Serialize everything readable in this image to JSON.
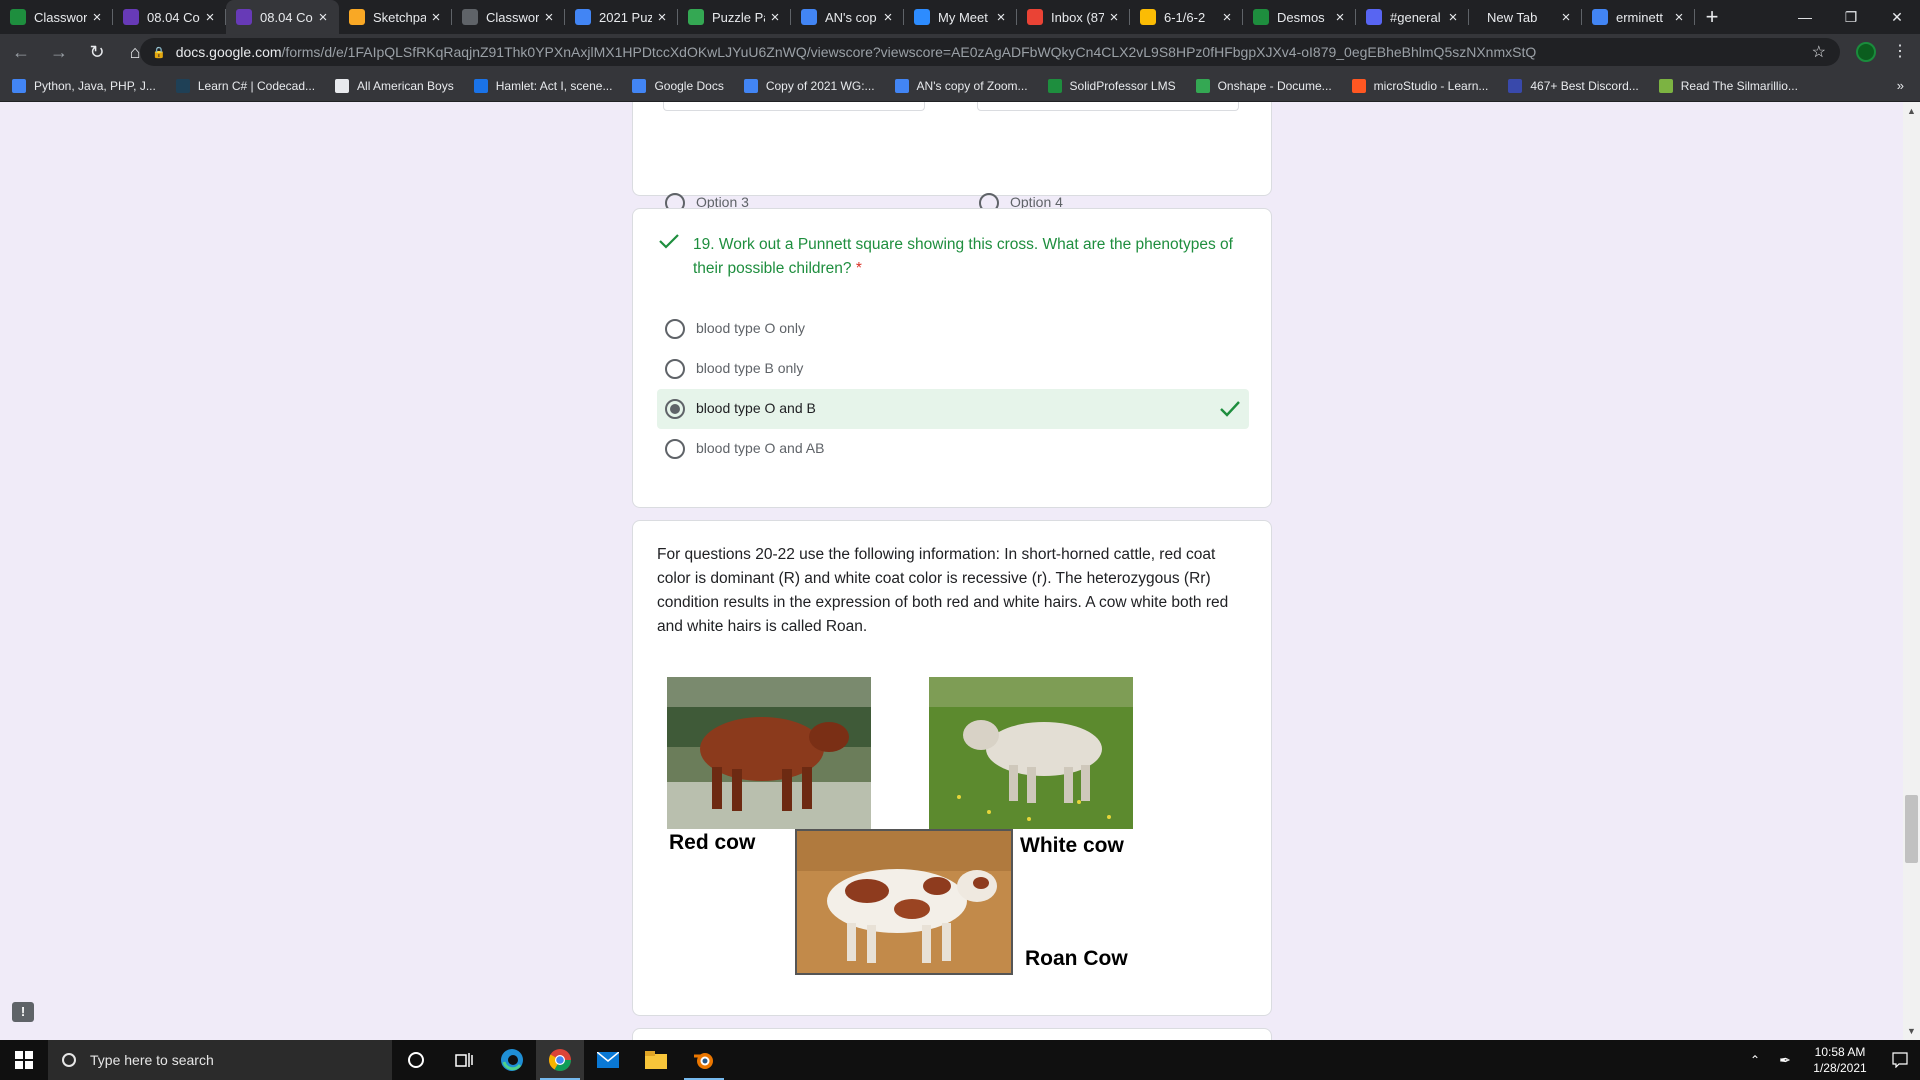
{
  "browser": {
    "tabs": [
      {
        "title": "Classwork",
        "favicon_color": "#1e8e3e",
        "active": false
      },
      {
        "title": "08.04 Co",
        "favicon_color": "#673ab7",
        "active": false
      },
      {
        "title": "08.04 Co",
        "favicon_color": "#673ab7",
        "active": true
      },
      {
        "title": "Sketchpa",
        "favicon_color": "#f9a825",
        "active": false
      },
      {
        "title": "Classwor",
        "favicon_color": "#5f6368",
        "active": false
      },
      {
        "title": "2021 Puz",
        "favicon_color": "#4285f4",
        "active": false
      },
      {
        "title": "Puzzle Pa",
        "favicon_color": "#34a853",
        "active": false
      },
      {
        "title": "AN's cop",
        "favicon_color": "#4285f4",
        "active": false
      },
      {
        "title": "My Meet",
        "favicon_color": "#2d8cff",
        "active": false
      },
      {
        "title": "Inbox (87",
        "favicon_color": "#ea4335",
        "active": false
      },
      {
        "title": "6-1/6-2",
        "favicon_color": "#fbbc04",
        "active": false
      },
      {
        "title": "Desmos",
        "favicon_color": "#1e8e3e",
        "active": false
      },
      {
        "title": "#general",
        "favicon_color": "#5865f2",
        "active": false
      },
      {
        "title": "New Tab",
        "favicon_color": "",
        "active": false
      },
      {
        "title": "erminett",
        "favicon_color": "#4285f4",
        "active": false
      }
    ],
    "new_tab_label": "+",
    "url_host": "docs.google.com",
    "url_path": "/forms/d/e/1FAIpQLSfRKqRaqjnZ91Thk0YPXnAxjlMX1HPDtccXdOKwLJYuU6ZnWQ/viewscore?viewscore=AE0zAgADFbWQkyCn4CLX2vL9S8HPz0fHFbgpXJXv4-oI879_0egEBheBhlmQ5szNXnmxStQ",
    "bookmarks": [
      {
        "label": "Python, Java, PHP, J...",
        "color": "#4285f4"
      },
      {
        "label": "Learn C# | Codecad...",
        "color": "#1f4056"
      },
      {
        "label": "All American Boys",
        "color": "#e8eaed"
      },
      {
        "label": "Hamlet: Act I, scene...",
        "color": "#1a73e8"
      },
      {
        "label": "Google Docs",
        "color": "#4285f4"
      },
      {
        "label": "Copy of 2021 WG:...",
        "color": "#4285f4"
      },
      {
        "label": "AN's copy of Zoom...",
        "color": "#4285f4"
      },
      {
        "label": "SolidProfessor LMS",
        "color": "#1e8e3e"
      },
      {
        "label": "Onshape - Docume...",
        "color": "#34a853"
      },
      {
        "label": "microStudio - Learn...",
        "color": "#ff5722"
      },
      {
        "label": "467+ Best Discord...",
        "color": "#3949ab"
      },
      {
        "label": "Read The Silmarillio...",
        "color": "#7cb342"
      }
    ],
    "bookmarks_more": "»"
  },
  "form": {
    "prev_question": {
      "options": [
        "Option 3",
        "Option 4"
      ]
    },
    "question19": {
      "title": "19. Work out a Punnett square showing this cross. What are the phenotypes of their possible children?",
      "required_mark": "*",
      "options": [
        {
          "label": "blood type O only",
          "selected": false,
          "correct": false
        },
        {
          "label": "blood type B only",
          "selected": false,
          "correct": false
        },
        {
          "label": "blood type O and B",
          "selected": true,
          "correct": true
        },
        {
          "label": "blood type O and AB",
          "selected": false,
          "correct": false
        }
      ],
      "status_color": "#1e8e3e"
    },
    "info_block": {
      "text": "For questions 20-22 use the following information: In short-horned cattle, red coat color is dominant (R) and white coat color is recessive (r). The heterozygous (Rr) condition results in the expression of both red and white hairs. A cow white both red and white hairs is called Roan.",
      "captions": {
        "red": "Red cow",
        "white": "White cow",
        "roan": "Roan Cow"
      }
    }
  },
  "taskbar": {
    "search_placeholder": "Type here to search",
    "time": "10:58 AM",
    "date": "1/28/2021"
  },
  "colors": {
    "page_bg": "#f0ebf8",
    "correct_green": "#1e8e3e",
    "correct_bg": "#e6f4ea"
  }
}
